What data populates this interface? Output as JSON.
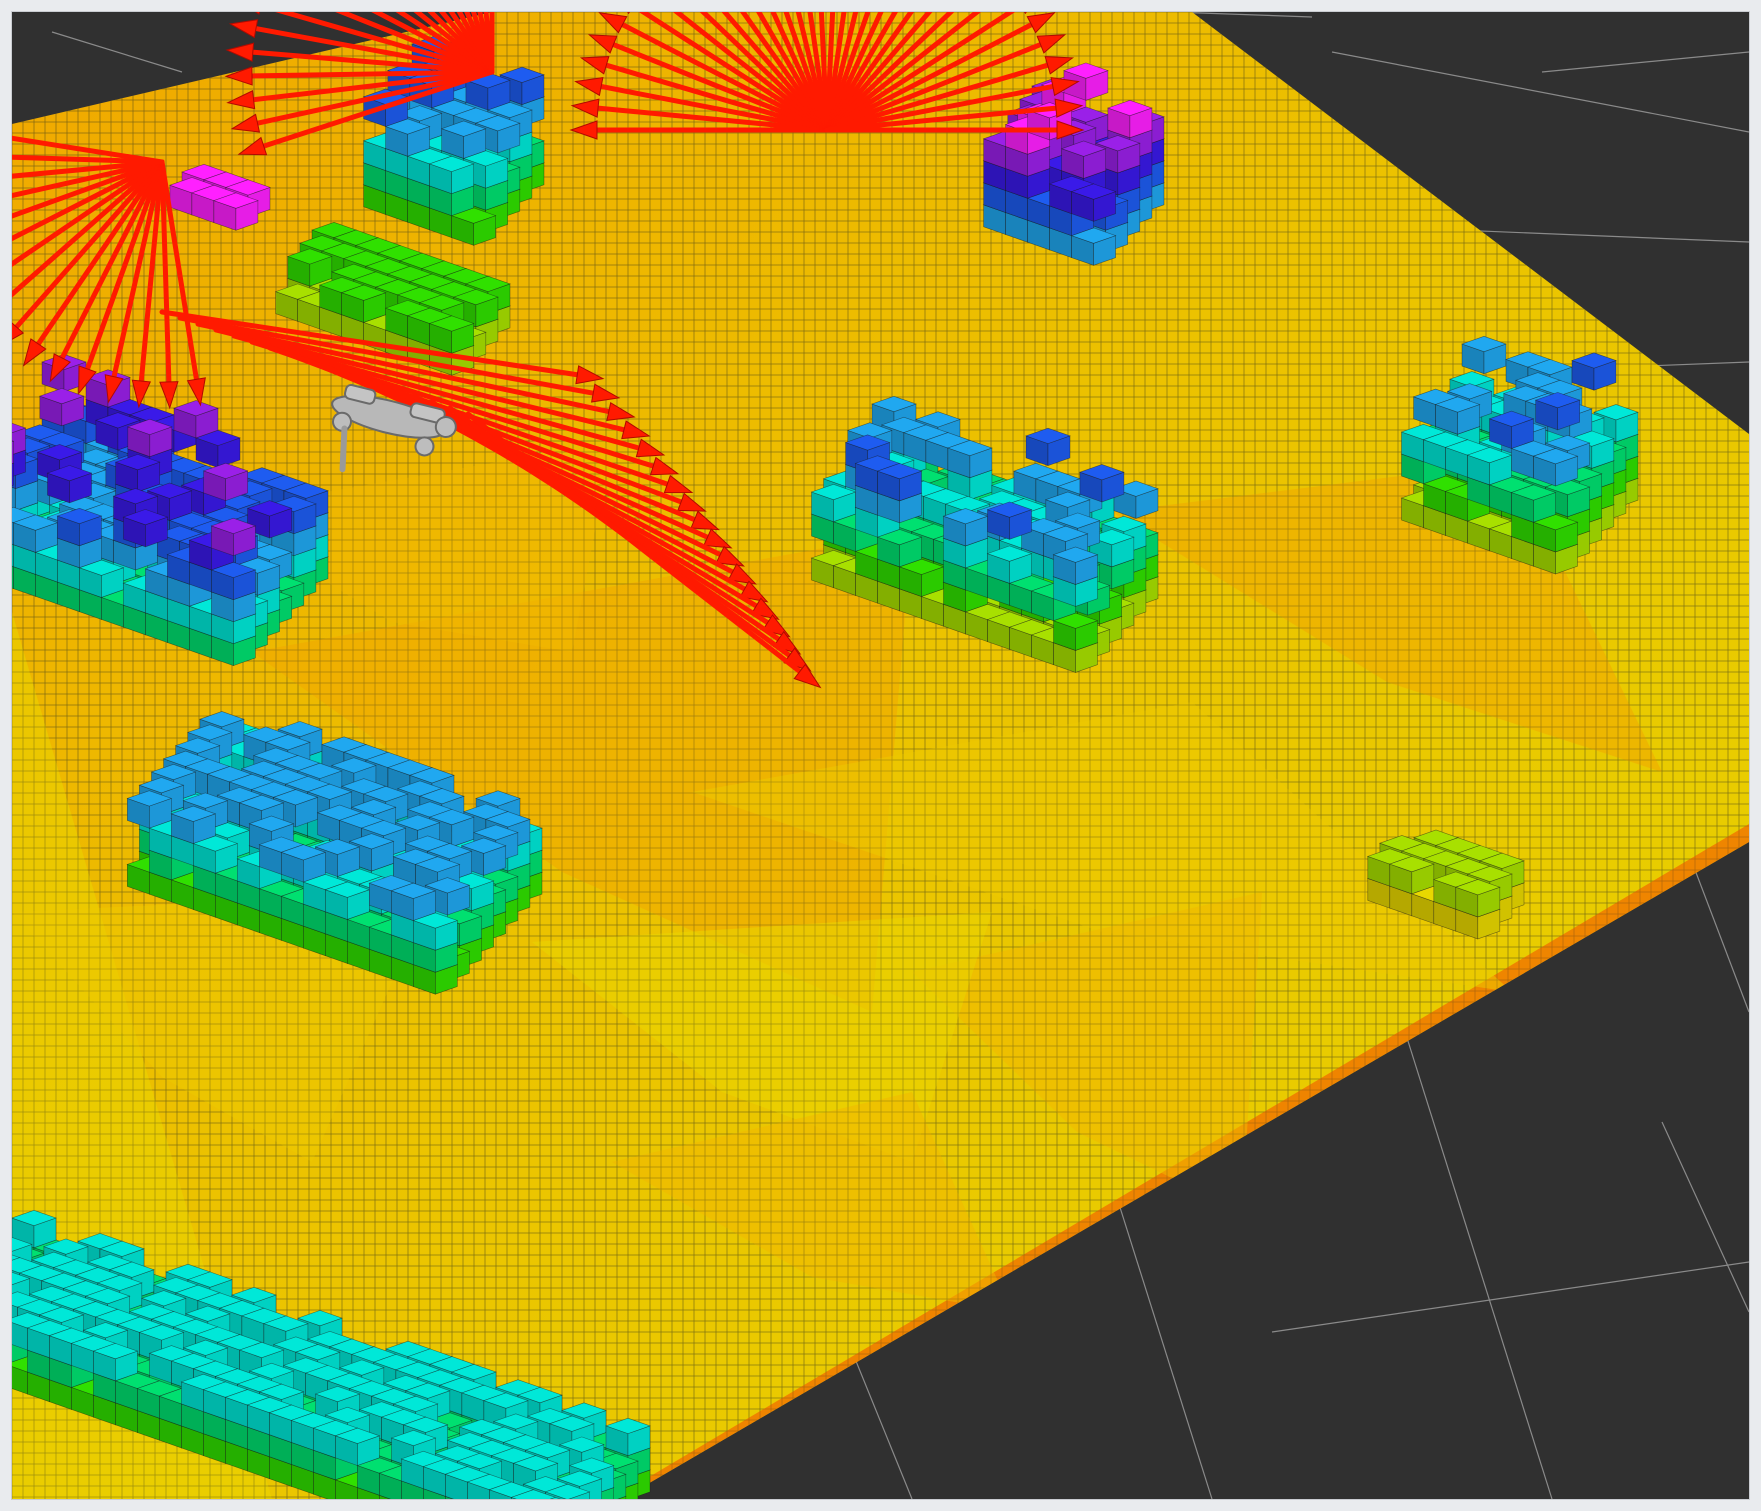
{
  "viewer": {
    "background": "#303030",
    "grid_line_color": "#8a8a8a",
    "frame_color": "#e9ebee"
  },
  "octomap": {
    "colormap": "height",
    "color_ramp": [
      "#f08c00",
      "#f2b400",
      "#e8d800",
      "#a8e000",
      "#30e000",
      "#00e070",
      "#00e8d8",
      "#20a8f0",
      "#1e5cf0",
      "#3a1ae8",
      "#9a20e8",
      "#ff20ff"
    ],
    "floor_colors": [
      "#f0a800",
      "#f0b800",
      "#ecc800",
      "#e9d600"
    ],
    "cell_outline_color": "#3a3a1a"
  },
  "pose_array": {
    "arrow_color": "#ff1a00",
    "arrow_edge_color": "#b00a00"
  },
  "robot_model": {
    "color": "#b8b8b8",
    "name": "quadruped"
  }
}
